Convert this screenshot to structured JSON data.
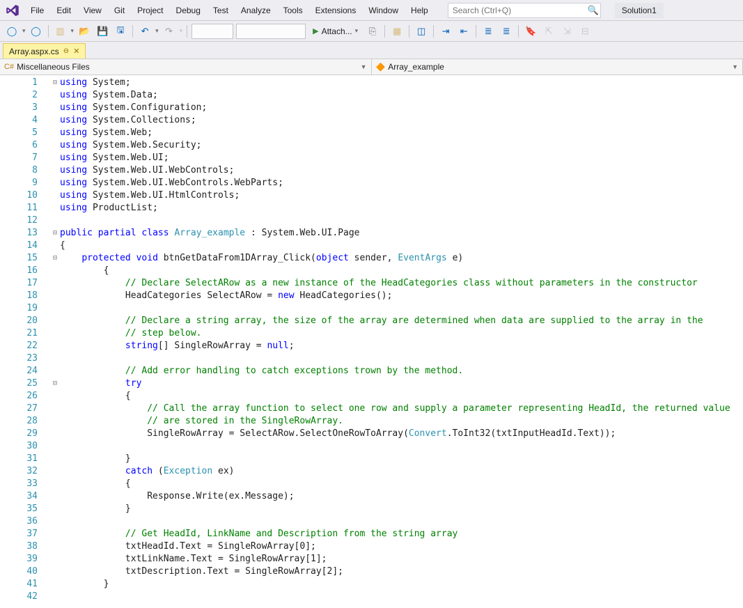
{
  "menubar": {
    "items": [
      "File",
      "Edit",
      "View",
      "Git",
      "Project",
      "Debug",
      "Test",
      "Analyze",
      "Tools",
      "Extensions",
      "Window",
      "Help"
    ],
    "search_placeholder": "Search (Ctrl+Q)",
    "solution": "Solution1"
  },
  "toolbar": {
    "attach_label": "Attach..."
  },
  "tab": {
    "filename": "Array.aspx.cs"
  },
  "navbar": {
    "left": "Miscellaneous Files",
    "right": "Array_example"
  },
  "code_lines": [
    {
      "n": 1,
      "fold": "⊟",
      "html": "<span class='kw'>using</span> System;"
    },
    {
      "n": 2,
      "fold": "",
      "html": "<span class='kw'>using</span> System.Data;"
    },
    {
      "n": 3,
      "fold": "",
      "html": "<span class='kw'>using</span> System.Configuration;"
    },
    {
      "n": 4,
      "fold": "",
      "html": "<span class='kw'>using</span> System.Collections;"
    },
    {
      "n": 5,
      "fold": "",
      "html": "<span class='kw'>using</span> System.Web;"
    },
    {
      "n": 6,
      "fold": "",
      "html": "<span class='kw'>using</span> System.Web.Security;"
    },
    {
      "n": 7,
      "fold": "",
      "html": "<span class='kw'>using</span> System.Web.UI;"
    },
    {
      "n": 8,
      "fold": "",
      "html": "<span class='kw'>using</span> System.Web.UI.WebControls;"
    },
    {
      "n": 9,
      "fold": "",
      "html": "<span class='kw'>using</span> System.Web.UI.WebControls.WebParts;"
    },
    {
      "n": 10,
      "fold": "",
      "html": "<span class='kw'>using</span> System.Web.UI.HtmlControls;"
    },
    {
      "n": 11,
      "fold": "",
      "html": "<span class='kw'>using</span> ProductList;"
    },
    {
      "n": 12,
      "fold": "",
      "html": ""
    },
    {
      "n": 13,
      "fold": "⊟",
      "html": "<span class='kw'>public</span> <span class='kw'>partial</span> <span class='kw'>class</span> <span class='type'>Array_example</span> : System.Web.UI.Page"
    },
    {
      "n": 14,
      "fold": "",
      "html": "{"
    },
    {
      "n": 15,
      "fold": "⊟",
      "html": "    <span class='kw'>protected</span> <span class='kw'>void</span> btnGetDataFrom1DArray_Click(<span class='kw'>object</span> sender, <span class='type'>EventArgs</span> e)"
    },
    {
      "n": 16,
      "fold": "",
      "html": "        {"
    },
    {
      "n": 17,
      "fold": "",
      "html": "            <span class='cm'>// Declare SelectARow as a new instance of the HeadCategories class without parameters in the constructor</span>"
    },
    {
      "n": 18,
      "fold": "",
      "html": "            HeadCategories SelectARow = <span class='kw'>new</span> HeadCategories();"
    },
    {
      "n": 19,
      "fold": "",
      "html": ""
    },
    {
      "n": 20,
      "fold": "",
      "html": "            <span class='cm'>// Declare a string array, the size of the array are determined when data are supplied to the array in the</span>"
    },
    {
      "n": 21,
      "fold": "",
      "html": "            <span class='cm'>// step below.</span>"
    },
    {
      "n": 22,
      "fold": "",
      "html": "            <span class='kw'>string</span>[] SingleRowArray = <span class='kw'>null</span>;"
    },
    {
      "n": 23,
      "fold": "",
      "html": ""
    },
    {
      "n": 24,
      "fold": "",
      "html": "            <span class='cm'>// Add error handling to catch exceptions trown by the method.</span>"
    },
    {
      "n": 25,
      "fold": "⊟",
      "html": "            <span class='kw'>try</span>"
    },
    {
      "n": 26,
      "fold": "",
      "html": "            {"
    },
    {
      "n": 27,
      "fold": "",
      "html": "                <span class='cm'>// Call the array function to select one row and supply a parameter representing HeadId, the returned value</span>"
    },
    {
      "n": 28,
      "fold": "",
      "html": "                <span class='cm'>// are stored in the SingleRowArray.</span>"
    },
    {
      "n": 29,
      "fold": "",
      "html": "                SingleRowArray = SelectARow.SelectOneRowToArray(<span class='type'>Convert</span>.ToInt32(txtInputHeadId.Text));"
    },
    {
      "n": 30,
      "fold": "",
      "html": ""
    },
    {
      "n": 31,
      "fold": "",
      "html": "            }"
    },
    {
      "n": 32,
      "fold": "",
      "html": "            <span class='kw'>catch</span> (<span class='type'>Exception</span> ex)"
    },
    {
      "n": 33,
      "fold": "",
      "html": "            {"
    },
    {
      "n": 34,
      "fold": "",
      "html": "                Response.Write(ex.Message);"
    },
    {
      "n": 35,
      "fold": "",
      "html": "            }"
    },
    {
      "n": 36,
      "fold": "",
      "html": ""
    },
    {
      "n": 37,
      "fold": "",
      "html": "            <span class='cm'>// Get HeadId, LinkName and Description from the string array</span>"
    },
    {
      "n": 38,
      "fold": "",
      "html": "            txtHeadId.Text = SingleRowArray[0];"
    },
    {
      "n": 39,
      "fold": "",
      "html": "            txtLinkName.Text = SingleRowArray[1];"
    },
    {
      "n": 40,
      "fold": "",
      "html": "            txtDescription.Text = SingleRowArray[2];"
    },
    {
      "n": 41,
      "fold": "",
      "html": "        }"
    },
    {
      "n": 42,
      "fold": "",
      "html": ""
    }
  ]
}
